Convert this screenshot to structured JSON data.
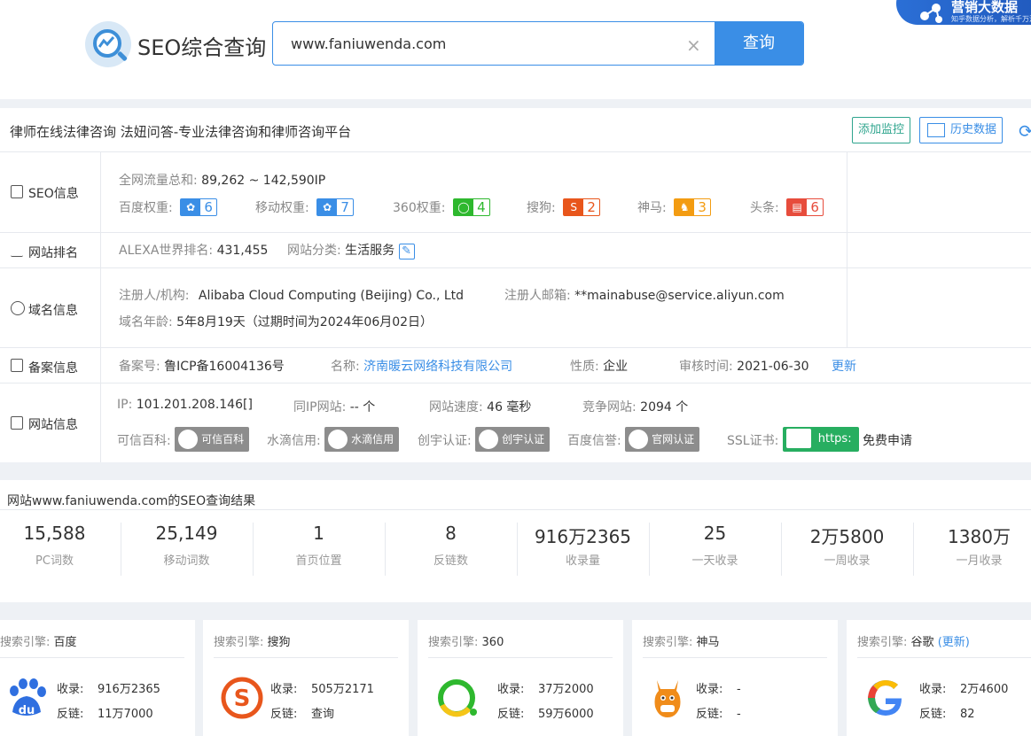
{
  "header": {
    "brand": "SEO综合查询",
    "search_value": "www.faniuwenda.com",
    "clear_label": "×",
    "search_button": "查询",
    "corner_title": "营销大数据",
    "corner_subtitle": "知乎数据分析，解析千万流"
  },
  "site": {
    "title": "律师在线法律咨询 法妞问答-专业法律咨询和律师咨询平台",
    "monitor_button": "添加监控",
    "history_button": "历史数据"
  },
  "seo": {
    "label": "SEO信息",
    "traffic_label": "全网流量总和:",
    "traffic_value": "89,262 ~ 142,590IP",
    "weights": [
      {
        "label": "百度权重:",
        "value": "6",
        "color": "#3a8ee6",
        "icon": "baidu-paw-icon"
      },
      {
        "label": "移动权重:",
        "value": "7",
        "color": "#3a8ee6",
        "icon": "baidu-paw-icon"
      },
      {
        "label": "360权重:",
        "value": "4",
        "color": "#2eb82e",
        "icon": "360-ring-icon"
      },
      {
        "label": "搜狗:",
        "value": "2",
        "color": "#e8561c",
        "icon": "sogou-s-icon"
      },
      {
        "label": "神马:",
        "value": "3",
        "color": "#f39c12",
        "icon": "shenma-icon"
      },
      {
        "label": "头条:",
        "value": "6",
        "color": "#e74c3c",
        "icon": "toutiao-icon"
      }
    ]
  },
  "rank": {
    "label": "网站排名",
    "alexa_label": "ALEXA世界排名:",
    "alexa_value": "431,455",
    "category_label": "网站分类:",
    "category_value": "生活服务"
  },
  "domain": {
    "label": "域名信息",
    "registrant_label": "注册人/机构:",
    "registrant_value": "Alibaba Cloud Computing (Beijing) Co., Ltd",
    "email_label": "注册人邮箱:",
    "email_value": "**mainabuse@service.aliyun.com",
    "age_label": "域名年龄:",
    "age_value": "5年8月19天（过期时间为2024年06月02日）"
  },
  "icp": {
    "label": "备案信息",
    "number_label": "备案号:",
    "number_value": "鲁ICP备16004136号",
    "name_label": "名称:",
    "name_value": "济南暖云网络科技有限公司",
    "type_label": "性质:",
    "type_value": "企业",
    "audit_label": "审核时间:",
    "audit_value": "2021-06-30",
    "update_link": "更新"
  },
  "webinfo": {
    "label": "网站信息",
    "ip_label": "IP:",
    "ip_value": "101.201.208.146[]",
    "same_ip_label": "同IP网站:",
    "same_ip_value": "-- 个",
    "speed_label": "网站速度:",
    "speed_value": "46 毫秒",
    "compete_label": "竞争网站:",
    "compete_value": "2094 个",
    "kexin_label": "可信百科:",
    "kexin_badge": "可信百科",
    "shuidi_label": "水滴信用:",
    "shuidi_badge": "水滴信用",
    "chuangyu_label": "创宇认证:",
    "chuangyu_badge": "创宇认证",
    "baidu_label": "百度信誉:",
    "baidu_badge": "官网认证",
    "ssl_label": "SSL证书:",
    "ssl_badge": "https:",
    "ssl_apply": "免费申请"
  },
  "results": {
    "title": "网站www.faniuwenda.com的SEO查询结果",
    "stats": [
      {
        "value": "15,588",
        "caption": "PC词数"
      },
      {
        "value": "25,149",
        "caption": "移动词数"
      },
      {
        "value": "1",
        "caption": "首页位置"
      },
      {
        "value": "8",
        "caption": "反链数"
      },
      {
        "value": "916万2365",
        "caption": "收录量"
      },
      {
        "value": "25",
        "caption": "一天收录"
      },
      {
        "value": "2万5800",
        "caption": "一周收录"
      },
      {
        "value": "1380万",
        "caption": "一月收录"
      }
    ]
  },
  "engines": [
    {
      "prefix": "搜索引擎:",
      "name": "百度",
      "extra": "",
      "index_label": "收录:",
      "index_value": "916万2365",
      "link_label": "反链:",
      "link_value": "11万7000"
    },
    {
      "prefix": "搜索引擎:",
      "name": "搜狗",
      "extra": "",
      "index_label": "收录:",
      "index_value": "505万2171",
      "link_label": "反链:",
      "link_value": "查询"
    },
    {
      "prefix": "搜索引擎:",
      "name": "360",
      "extra": "",
      "index_label": "收录:",
      "index_value": "37万2000",
      "link_label": "反链:",
      "link_value": "59万6000"
    },
    {
      "prefix": "搜索引擎:",
      "name": "神马",
      "extra": "",
      "index_label": "收录:",
      "index_value": "-",
      "link_label": "反链:",
      "link_value": "-"
    },
    {
      "prefix": "搜索引擎:",
      "name": "谷歌",
      "extra": "(更新)",
      "index_label": "收录:",
      "index_value": "2万4600",
      "link_label": "反链:",
      "link_value": "82"
    }
  ]
}
